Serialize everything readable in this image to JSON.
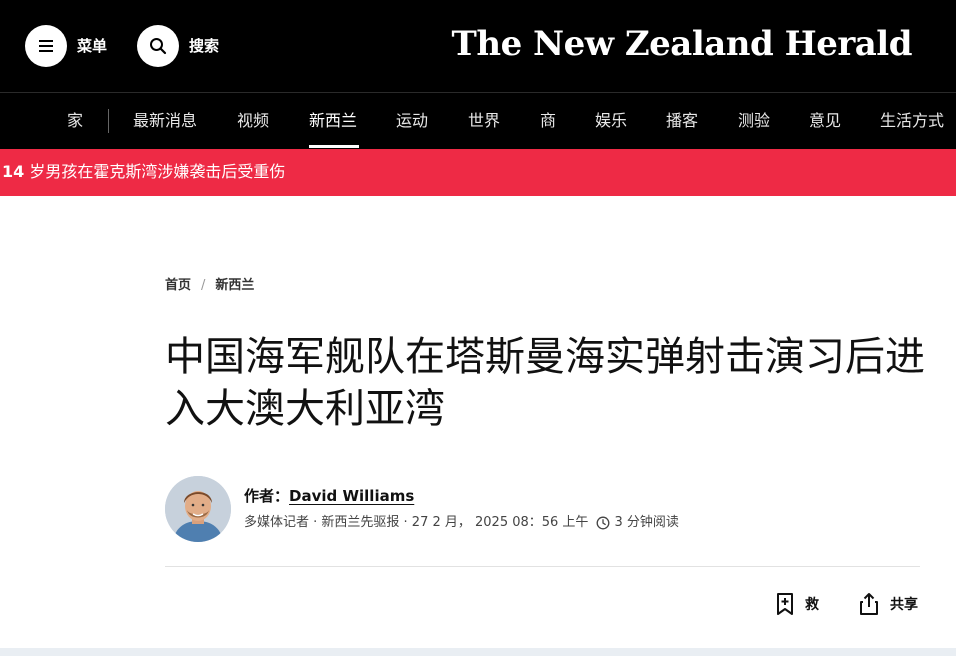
{
  "header": {
    "menu_label": "菜单",
    "search_label": "搜索",
    "masthead": "The New Zealand Herald"
  },
  "nav": {
    "items": [
      "家",
      "最新消息",
      "视频",
      "新西兰",
      "运动",
      "世界",
      "商",
      "娱乐",
      "播客",
      "测验",
      "意见",
      "生活方式"
    ],
    "active": "新西兰"
  },
  "breaking": {
    "number": "14",
    "text": " 岁男孩在霍克斯湾涉嫌袭击后受重伤"
  },
  "article": {
    "breadcrumb": [
      "首页",
      "新西兰"
    ],
    "breadcrumb_separator": "/",
    "headline": "中国海军舰队在塔斯曼海实弹射击演习后进入大澳大利亚湾",
    "author_prefix": "作者：",
    "author_name": "David Williams",
    "author_role": "多媒体记者 · 新西兰先驱报 · 27 2 月， 2025 08：56 上午",
    "read_time": "3 分钟阅读"
  },
  "actions": {
    "save_label": "救",
    "share_label": "共享"
  },
  "colors": {
    "topbar": "#000000",
    "breaking": "#ee2a45",
    "text": "#111111"
  }
}
